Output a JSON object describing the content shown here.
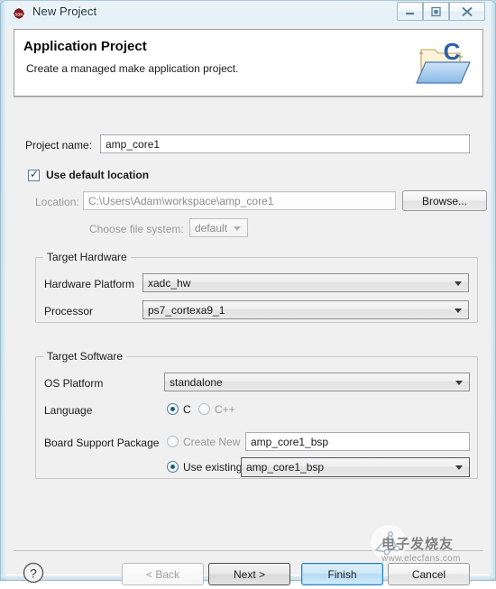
{
  "window": {
    "title": "New Project",
    "app_icon": "sdk-logo-icon",
    "caption_buttons": {
      "minimize": "minimize-icon",
      "maximize": "restore-icon",
      "close": "close-icon"
    }
  },
  "banner": {
    "title": "Application Project",
    "subtitle": "Create a managed make application project.",
    "icon": "c-project-folder-icon"
  },
  "form": {
    "project_name_label": "Project name:",
    "project_name_value": "amp_core1",
    "use_default_location_label": "Use default location",
    "use_default_location_checked": true,
    "location_label": "Location:",
    "location_value": "C:\\Users\\Adam\\workspace\\amp_core1",
    "browse_label": "Browse...",
    "file_system_label": "Choose file system:",
    "file_system_value": "default"
  },
  "target_hardware": {
    "group_title": "Target Hardware",
    "hardware_platform_label": "Hardware Platform",
    "hardware_platform_value": "xadc_hw",
    "processor_label": "Processor",
    "processor_value": "ps7_cortexa9_1"
  },
  "target_software": {
    "group_title": "Target Software",
    "os_platform_label": "OS Platform",
    "os_platform_value": "standalone",
    "language_label": "Language",
    "language_c_label": "C",
    "language_cpp_label": "C++",
    "language_selected": "C",
    "bsp_label": "Board Support Package",
    "bsp_create_new_label": "Create New",
    "bsp_create_new_value": "amp_core1_bsp",
    "bsp_use_existing_label": "Use existing",
    "bsp_use_existing_value": "amp_core1_bsp",
    "bsp_selected": "Use existing"
  },
  "footer": {
    "help_icon": "help-question-icon",
    "back_label": "< Back",
    "back_disabled": true,
    "next_label": "Next >",
    "finish_label": "Finish",
    "cancel_label": "Cancel"
  },
  "watermark": {
    "text_cn": "电子发烧友",
    "url": "www.elecfans.com"
  },
  "colors": {
    "accent": "#2a7fb8",
    "radio_fill": "#1d5b86",
    "dialog_bg": "#f0f0f0",
    "banner_bg": "#ffffff"
  }
}
